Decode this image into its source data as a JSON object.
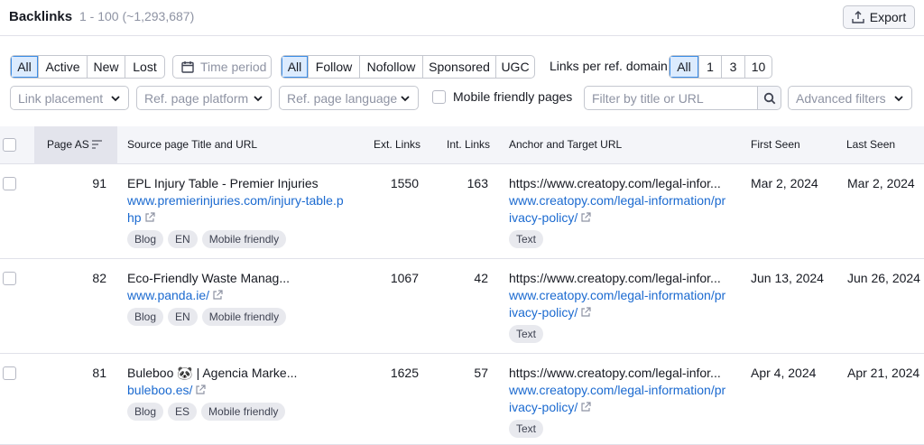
{
  "header": {
    "title": "Backlinks",
    "range": "1 - 100 (~1,293,687)",
    "export_label": "Export"
  },
  "filters": {
    "status_options": [
      "All",
      "Active",
      "New",
      "Lost"
    ],
    "status_selected": "All",
    "time_period": "Time period",
    "link_type_options": [
      "All",
      "Follow",
      "Nofollow",
      "Sponsored",
      "UGC"
    ],
    "link_type_selected": "All",
    "links_per_domain_label": "Links per ref. domain",
    "links_per_domain_options": [
      "All",
      "1",
      "3",
      "10"
    ],
    "links_per_domain_selected": "All",
    "link_placement": "Link placement",
    "ref_page_platform": "Ref. page platform",
    "ref_page_language": "Ref. page language",
    "mobile_friendly_label": "Mobile friendly pages",
    "search_placeholder": "Filter by title or URL",
    "advanced_filters": "Advanced filters"
  },
  "table": {
    "columns": {
      "page_as": "Page AS",
      "source": "Source page Title and URL",
      "ext_links": "Ext. Links",
      "int_links": "Int. Links",
      "anchor": "Anchor and Target URL",
      "first_seen": "First Seen",
      "last_seen": "Last Seen"
    },
    "rows": [
      {
        "page_as": "91",
        "title": "EPL Injury Table  - Premier Injuries",
        "url_line1": "www.premierinjuries.com/injury-table.p",
        "url_line2": "hp",
        "tags": [
          "Blog",
          "EN",
          "Mobile friendly"
        ],
        "ext_links": "1550",
        "int_links": "163",
        "anchor": "https://www.creatopy.com/legal-infor...",
        "target_line1": "www.creatopy.com/legal-information/pr",
        "target_line2": "ivacy-policy/",
        "anchor_tag": "Text",
        "first_seen": "Mar 2, 2024",
        "last_seen": "Mar 2, 2024"
      },
      {
        "page_as": "82",
        "title": "Eco-Friendly Waste Manag...",
        "url_line1": "www.panda.ie/",
        "url_line2": "",
        "tags": [
          "Blog",
          "EN",
          "Mobile friendly"
        ],
        "ext_links": "1067",
        "int_links": "42",
        "anchor": "https://www.creatopy.com/legal-infor...",
        "target_line1": "www.creatopy.com/legal-information/pr",
        "target_line2": "ivacy-policy/",
        "anchor_tag": "Text",
        "first_seen": "Jun 13, 2024",
        "last_seen": "Jun 26, 2024"
      },
      {
        "page_as": "81",
        "title": "Buleboo 🐼 | Agencia Marke...",
        "url_line1": "buleboo.es/",
        "url_line2": "",
        "tags": [
          "Blog",
          "ES",
          "Mobile friendly"
        ],
        "ext_links": "1625",
        "int_links": "57",
        "anchor": "https://www.creatopy.com/legal-infor...",
        "target_line1": "www.creatopy.com/legal-information/pr",
        "target_line2": "ivacy-policy/",
        "anchor_tag": "Text",
        "first_seen": "Apr 4, 2024",
        "last_seen": "Apr 21, 2024"
      }
    ]
  },
  "colors": {
    "link": "#1b6ad0",
    "active_segment": "#dcebfe",
    "active_border": "#3b8de6"
  },
  "icons": [
    "export-icon",
    "calendar-icon",
    "chevron-down-icon",
    "search-icon",
    "sort-icon",
    "external-link-icon"
  ]
}
